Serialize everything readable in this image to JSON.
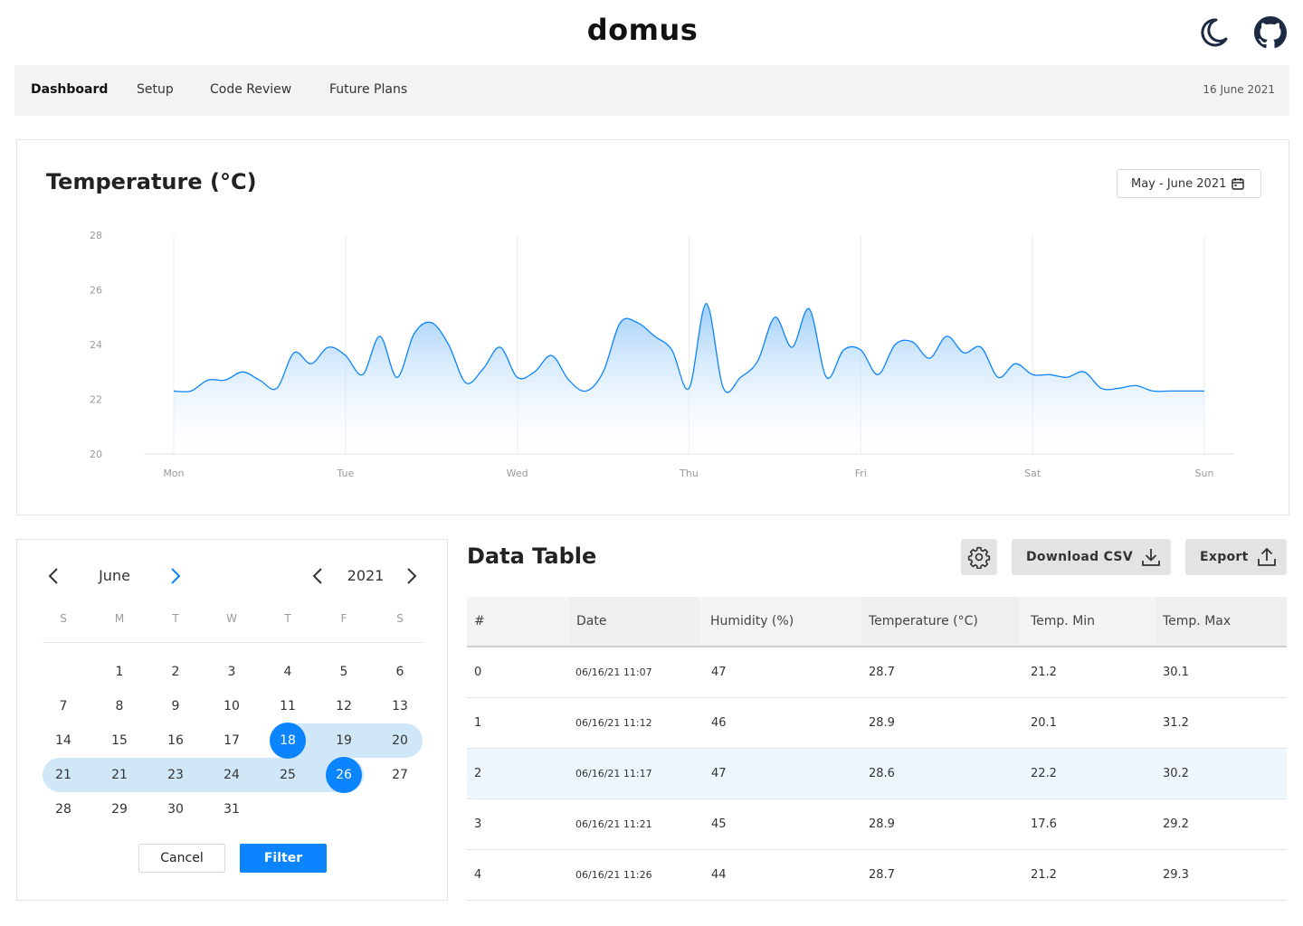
{
  "app": {
    "logo": "domus"
  },
  "header_icons": {
    "theme": "moon-icon",
    "repo": "github-icon"
  },
  "nav": {
    "items": [
      {
        "label": "Dashboard",
        "active": true
      },
      {
        "label": "Setup",
        "active": false
      },
      {
        "label": "Code Review",
        "active": false
      },
      {
        "label": "Future Plans",
        "active": false
      }
    ],
    "date": "16 June 2021"
  },
  "chart_section": {
    "range_label": "May - June 2021"
  },
  "chart_data": {
    "type": "area",
    "title": "Temperature (°C)",
    "xlabel": "",
    "ylabel": "",
    "x_ticks": [
      "Mon",
      "Tue",
      "Wed",
      "Thu",
      "Fri",
      "Sat",
      "Sun"
    ],
    "y_ticks": [
      "28",
      "26",
      "24",
      "22",
      "20"
    ],
    "ylim": [
      20,
      28
    ],
    "xlim": [
      0,
      6
    ],
    "grid": "vertical",
    "color": "#0a84ff",
    "x": [
      0,
      0.1,
      0.2,
      0.3,
      0.4,
      0.5,
      0.6,
      0.7,
      0.8,
      0.9,
      1,
      1.1,
      1.2,
      1.3,
      1.4,
      1.5,
      1.6,
      1.7,
      1.8,
      1.9,
      2,
      2.1,
      2.2,
      2.3,
      2.4,
      2.5,
      2.6,
      2.7,
      2.8,
      2.9,
      3,
      3.1,
      3.2,
      3.3,
      3.4,
      3.5,
      3.6,
      3.7,
      3.8,
      3.9,
      4,
      4.1,
      4.2,
      4.3,
      4.4,
      4.5,
      4.6,
      4.7,
      4.8,
      4.9,
      5,
      5.1,
      5.2,
      5.3,
      5.4,
      5.5,
      5.6,
      5.7,
      5.8,
      5.9,
      6
    ],
    "y": [
      22.3,
      22.3,
      22.7,
      22.7,
      23.0,
      22.7,
      22.4,
      23.7,
      23.3,
      23.9,
      23.6,
      22.9,
      24.3,
      22.8,
      24.4,
      24.8,
      24.0,
      22.6,
      23.1,
      23.9,
      22.8,
      23.0,
      23.6,
      22.7,
      22.3,
      23.0,
      24.8,
      24.8,
      24.3,
      23.8,
      22.4,
      25.5,
      22.4,
      22.8,
      23.4,
      25.0,
      23.9,
      25.3,
      22.8,
      23.8,
      23.8,
      22.9,
      24.0,
      24.1,
      23.5,
      24.3,
      23.7,
      23.9,
      22.8,
      23.3,
      22.9,
      22.9,
      22.8,
      23.0,
      22.4,
      22.4,
      22.5,
      22.3,
      22.3,
      22.3,
      22.3
    ]
  },
  "calendar": {
    "month": "June",
    "year": "2021",
    "weekdays": [
      "S",
      "M",
      "T",
      "W",
      "T",
      "F",
      "S"
    ],
    "weeks": [
      [
        "",
        "1",
        "2",
        "3",
        "4",
        "5",
        "6"
      ],
      [
        "7",
        "8",
        "9",
        "10",
        "11",
        "12",
        "13"
      ],
      [
        "14",
        "15",
        "16",
        "17",
        "18",
        "19",
        "20"
      ],
      [
        "21",
        "21",
        "23",
        "24",
        "25",
        "26",
        "27"
      ],
      [
        "28",
        "29",
        "30",
        "31",
        "",
        "",
        ""
      ]
    ],
    "selected_start": "18",
    "selected_end": "26",
    "cancel_label": "Cancel",
    "filter_label": "Filter"
  },
  "data_table": {
    "title": "Data Table",
    "download_label": "Download CSV",
    "export_label": "Export",
    "columns": [
      "#",
      "Date",
      "Humidity (%)",
      "Temperature (°C)",
      "Temp. Min",
      "Temp. Max"
    ],
    "rows": [
      [
        "0",
        "06/16/21 11:07",
        "47",
        "28.7",
        "21.2",
        "30.1"
      ],
      [
        "1",
        "06/16/21 11:12",
        "46",
        "28.9",
        "20.1",
        "31.2"
      ],
      [
        "2",
        "06/16/21 11:17",
        "47",
        "28.6",
        "22.2",
        "30.2"
      ],
      [
        "3",
        "06/16/21 11:21",
        "45",
        "28.9",
        "17.6",
        "29.2"
      ],
      [
        "4",
        "06/16/21 11:26",
        "44",
        "28.7",
        "21.2",
        "29.3"
      ]
    ],
    "highlighted_row": 2
  }
}
